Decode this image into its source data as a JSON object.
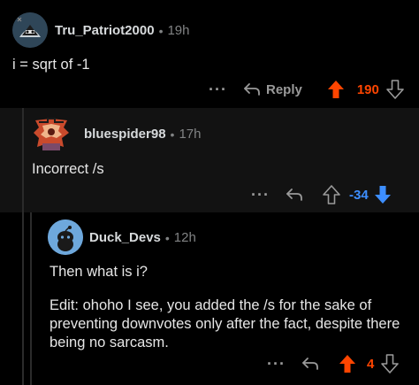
{
  "colors": {
    "upvote": "#ff4500",
    "downvote": "#3d8eff",
    "muted": "#9a9a9a"
  },
  "comments": [
    {
      "username": "Tru_Patriot2000",
      "separator": "•",
      "age": "19h",
      "body": [
        "i = sqrt of -1"
      ],
      "actions": {
        "more": "···",
        "reply": "Reply",
        "score": "190",
        "vote": "upvoted"
      }
    },
    {
      "username": "bluespider98",
      "separator": "•",
      "age": "17h",
      "body": [
        "Incorrect /s"
      ],
      "actions": {
        "more": "···",
        "score": "-34",
        "vote": "downvoted"
      }
    },
    {
      "username": "Duck_Devs",
      "separator": "•",
      "age": "12h",
      "body": [
        "Then what is i?",
        "Edit: ohoho I see, you added the /s for the sake of preventing downvotes only after the fact, despite there being no sarcasm."
      ],
      "actions": {
        "more": "···",
        "score": "4",
        "vote": "upvoted"
      }
    }
  ]
}
